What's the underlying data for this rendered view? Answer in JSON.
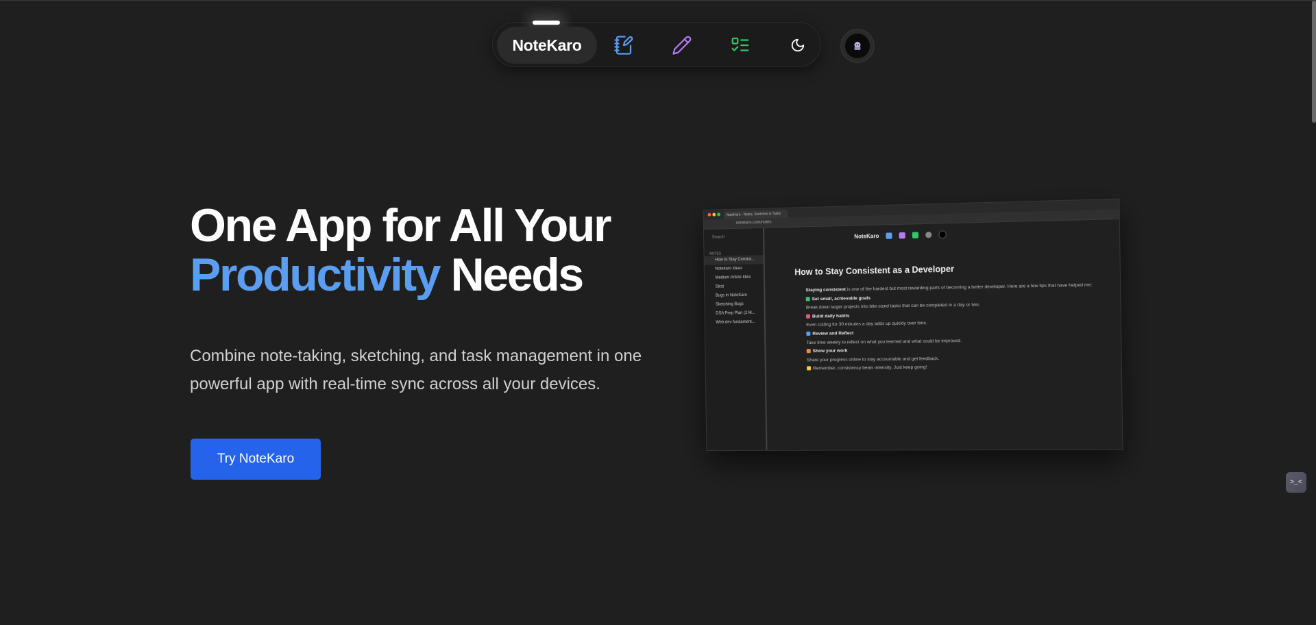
{
  "nav": {
    "brand": "NoteKaro",
    "items": [
      {
        "name": "notes",
        "icon": "notebook-pen-icon",
        "color": "#5b9df0"
      },
      {
        "name": "sketch",
        "icon": "pencil-icon",
        "color": "#b57bf2"
      },
      {
        "name": "tasks",
        "icon": "checklist-icon",
        "color": "#36c46a"
      },
      {
        "name": "theme",
        "icon": "moon-icon",
        "color": "#ffffff"
      }
    ],
    "avatar_icon": "user-avatar-icon"
  },
  "hero": {
    "title_line1": "One App for All Your",
    "title_accent": "Productivity",
    "title_rest": "Needs",
    "subtitle_line1": "Combine note-taking, sketching, and task management in one",
    "subtitle_line2": "powerful app with real-time sync across all your devices.",
    "cta_label": "Try NoteKaro",
    "accent_color": "#5b9df0",
    "cta_color": "#2563eb"
  },
  "preview": {
    "tab_title": "NoteKaro - Notes, Sketches & Tasks",
    "url": "notekaro.com/notes",
    "search_placeholder": "Search",
    "notes_heading": "NOTES",
    "notes": [
      "How to Stay Consist...",
      "Notekaro Ideas",
      "Medium Article Idea",
      "Strat",
      "Bugs in NoteKaro",
      "Sketching Bugs",
      "DSA Prep Plan (2 M...",
      "Web dev fundament..."
    ],
    "nav_brand": "NoteKaro",
    "doc_title": "How to Stay Consistent as a Developer",
    "intro_bold": "Staying consistent",
    "intro_rest": " is one of the hardest but most rewarding parts of becoming a better developer. Here are a few tips that have helped me:",
    "tips": [
      {
        "heading": "Set small, achievable goals",
        "text": "Break down larger projects into bite-sized tasks that can be completed in a day or two.",
        "color": "#36c46a"
      },
      {
        "heading": "Build daily habits",
        "text": "Even coding for 30 minutes a day adds up quickly over time.",
        "color": "#e05a7a"
      },
      {
        "heading": "Review and Reflect",
        "text": "Take time weekly to reflect on what you learned and what could be improved.",
        "color": "#5b9df0"
      },
      {
        "heading": "Show your work",
        "text": "Share your progress online to stay accountable and get feedback.",
        "color": "#e8894a"
      }
    ],
    "closing": "Remember, consistency beats intensity. Just keep going!"
  },
  "help_fab_label": ">_<"
}
